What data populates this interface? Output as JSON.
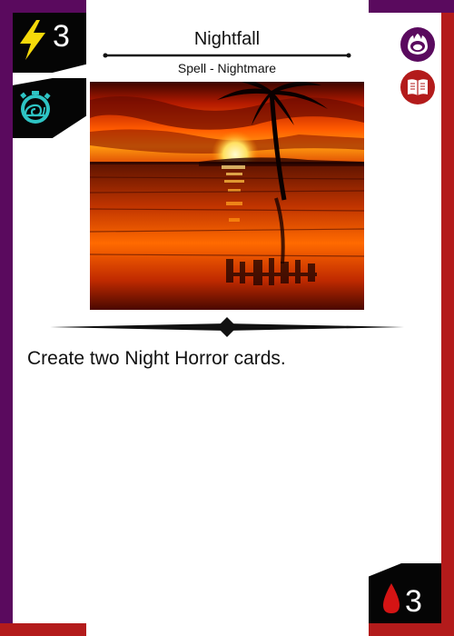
{
  "card": {
    "title": "Nightfall",
    "subtitle": "Spell - Nightmare",
    "text": "Create two Night Horror cards.",
    "energy": "3",
    "cost": "3"
  },
  "icons": {
    "energy": "lightning-icon",
    "speed": "snail-stopwatch-icon",
    "faction": "nightmare-faction-icon",
    "type": "spellbook-icon",
    "cost": "blood-drop-icon"
  },
  "colors": {
    "purple": "#5a0a5e",
    "red": "#b31b1b",
    "black": "#050505",
    "lightning": "#f5d90a",
    "snail": "#2ec4c4"
  }
}
